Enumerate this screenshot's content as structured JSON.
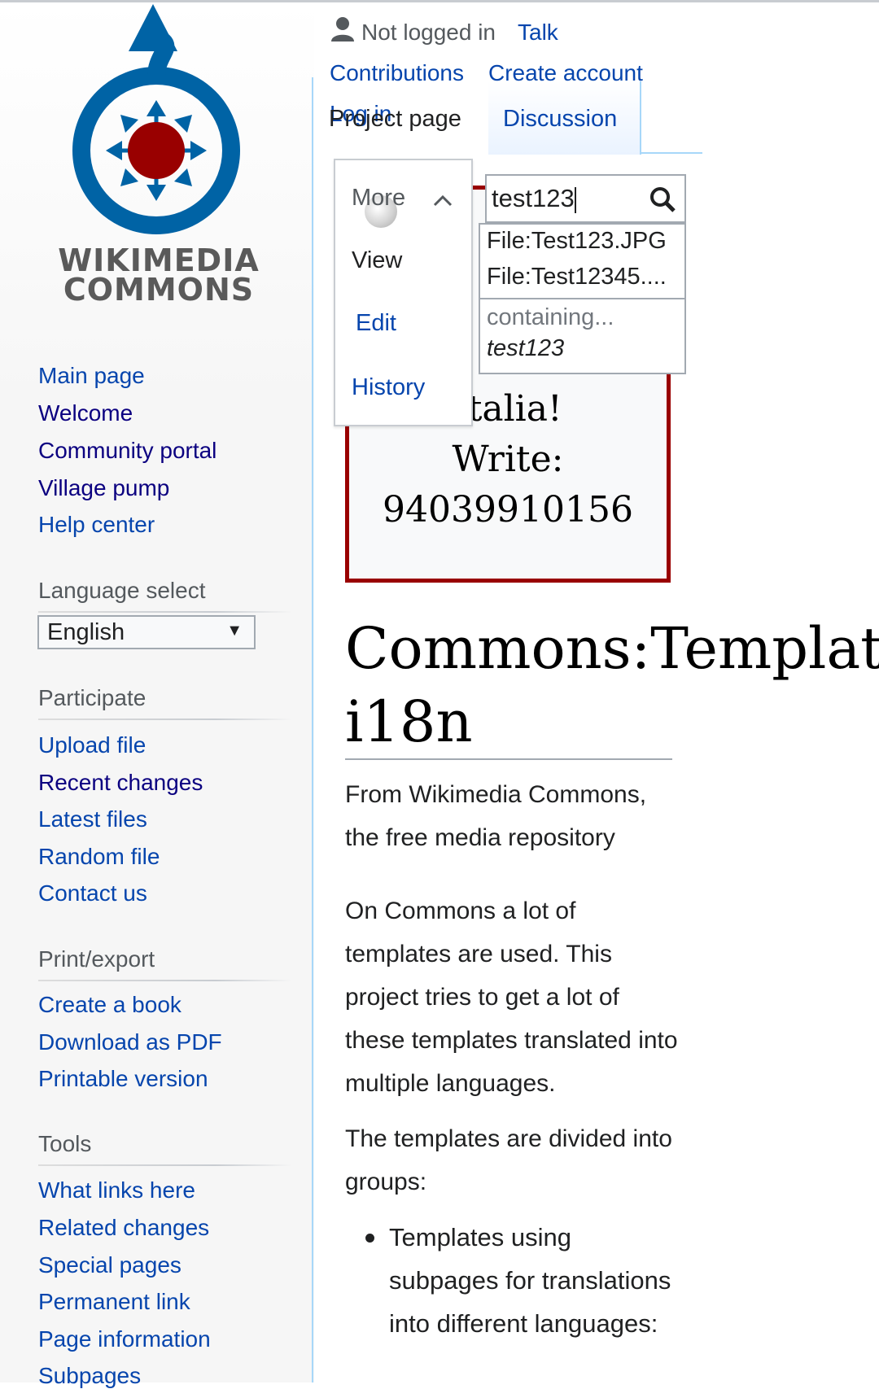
{
  "logo": {
    "line1": "WIKIMEDIA",
    "line2": "COMMONS"
  },
  "personal": {
    "status": "Not logged in",
    "talk": "Talk",
    "contributions": "Contributions",
    "create_account": "Create account",
    "login": "Log in"
  },
  "tabs": {
    "project": "Project page",
    "discussion": "Discussion"
  },
  "more_menu": {
    "label": "More",
    "items": [
      "View",
      "Edit",
      "History"
    ]
  },
  "search": {
    "value": "test123",
    "suggestions": [
      "File:Test123.JPG",
      "File:Test12345...."
    ],
    "containing": "containing...",
    "term": "test123"
  },
  "banner": {
    "lines": [
      "Italia!",
      "Write:",
      "94039910156"
    ]
  },
  "sidebar": {
    "nav": [
      "Main page",
      "Welcome",
      "Community portal",
      "Village pump",
      "Help center"
    ],
    "language_heading": "Language select",
    "language_value": "English",
    "participate_heading": "Participate",
    "participate": [
      "Upload file",
      "Recent changes",
      "Latest files",
      "Random file",
      "Contact us"
    ],
    "print_heading": "Print/export",
    "print": [
      "Create a book",
      "Download as PDF",
      "Printable version"
    ],
    "tools_heading": "Tools",
    "tools": [
      "What links here",
      "Related changes",
      "Special pages",
      "Permanent link",
      "Page information",
      "Subpages"
    ]
  },
  "content": {
    "title_line1": "Commons:Template",
    "title_line2": "i18n",
    "tagline": "From Wikimedia Commons, the free media repository",
    "para1": "On Commons a lot of templates are used. This project tries to get a lot of these templates translated into multiple languages.",
    "para2": "The templates are divided into groups:",
    "bullet1": "Templates using subpages for translations into different languages:"
  },
  "colors": {
    "link": "#0645ad",
    "visited": "#0b0080",
    "banner_border": "#990000",
    "logo_blue": "#0063a5",
    "logo_red": "#990000"
  }
}
